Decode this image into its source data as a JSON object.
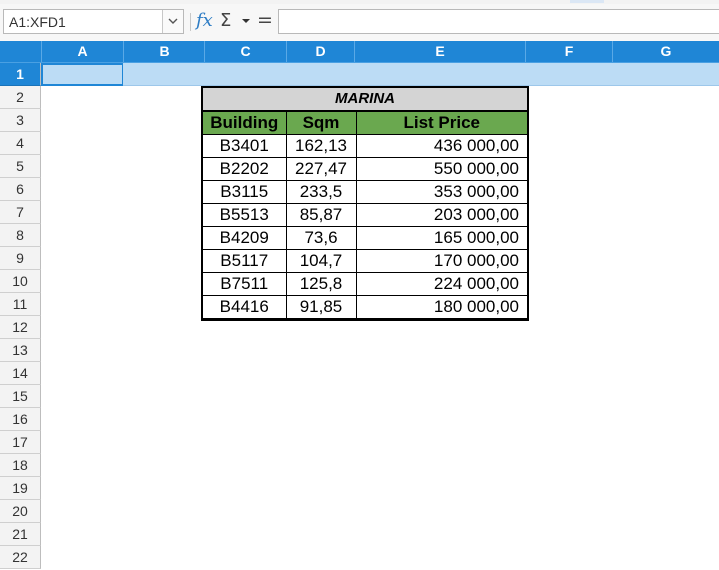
{
  "name_box": {
    "value": "A1:XFD1"
  },
  "formula_bar": {
    "fx": "fx",
    "sum": "Σ",
    "equals": "=",
    "content": ""
  },
  "columns": [
    "A",
    "B",
    "C",
    "D",
    "E",
    "F",
    "G"
  ],
  "rows": [
    "1",
    "2",
    "3",
    "4",
    "5",
    "6",
    "7",
    "8",
    "9",
    "10",
    "11",
    "12",
    "13",
    "14",
    "15",
    "16",
    "17",
    "18",
    "19",
    "20",
    "21",
    "22"
  ],
  "selection": {
    "selected_row": "1"
  },
  "table": {
    "title": "MARINA",
    "headers": [
      "Building",
      "Sqm",
      "List Price"
    ],
    "rows": [
      [
        "B3401",
        "162,13",
        "436 000,00"
      ],
      [
        "B2202",
        "227,47",
        "550 000,00"
      ],
      [
        "B3115",
        "233,5",
        "353 000,00"
      ],
      [
        "B5513",
        "85,87",
        "203 000,00"
      ],
      [
        "B4209",
        "73,6",
        "165 000,00"
      ],
      [
        "B5117",
        "104,7",
        "170 000,00"
      ],
      [
        "B7511",
        "125,8",
        "224 000,00"
      ],
      [
        "B4416",
        "91,85",
        "180 000,00"
      ]
    ]
  },
  "colors": {
    "header_blue": "#1f86d6",
    "selection_band": "#bcdcf5",
    "table_header_green": "#6aa84f",
    "title_gray": "#d4d4d4"
  }
}
